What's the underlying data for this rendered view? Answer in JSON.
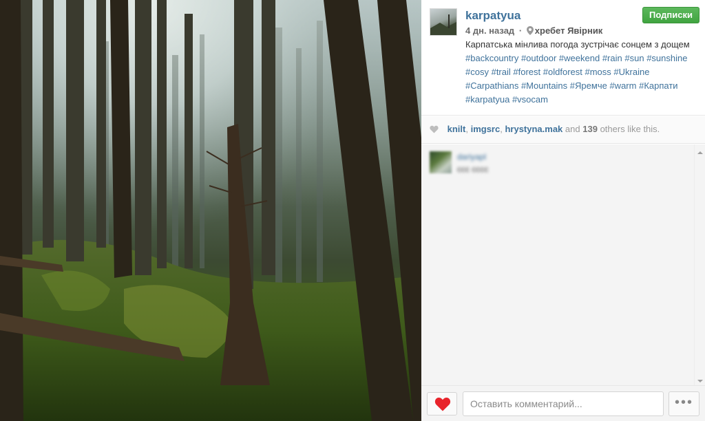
{
  "post": {
    "image_alt": "",
    "username": "karpatyua",
    "follow_label": "Подписки",
    "time_ago": "4 дн. назад",
    "location": "хребет Явірник",
    "caption_text": "Карпатська мінлива погода зустрічає сонцем з дощем",
    "hashtags": [
      "#backcountry",
      "#outdoor",
      "#weekend",
      "#rain",
      "#sun",
      "#sunshine",
      "#cosy",
      "#trail",
      "#forest",
      "#oldforest",
      "#moss",
      "#Ukraine",
      "#Carpathians",
      "#Mountains",
      "#Яремче",
      "#warm",
      "#Карпати",
      "#karpatyua",
      "#vsocam"
    ]
  },
  "likes": {
    "users": [
      "knilt",
      "imgsrc",
      "hrystyna.mak"
    ],
    "and_word": "and",
    "count": "139",
    "suffix": "others like this."
  },
  "comments": [
    {
      "user": "dariyapl",
      "text": "ccc cccc"
    }
  ],
  "footer": {
    "comment_placeholder": "Оставить комментарий...",
    "more_label": "•••"
  },
  "colors": {
    "link": "#3f729b",
    "follow_green": "#4cae4c",
    "heart_red": "#e8242b"
  },
  "icons": {
    "pin": "location-pin-icon",
    "like_small": "heart-icon",
    "like_button": "heart-icon",
    "scroll_up": "chevron-up-icon",
    "scroll_down": "chevron-down-icon"
  }
}
